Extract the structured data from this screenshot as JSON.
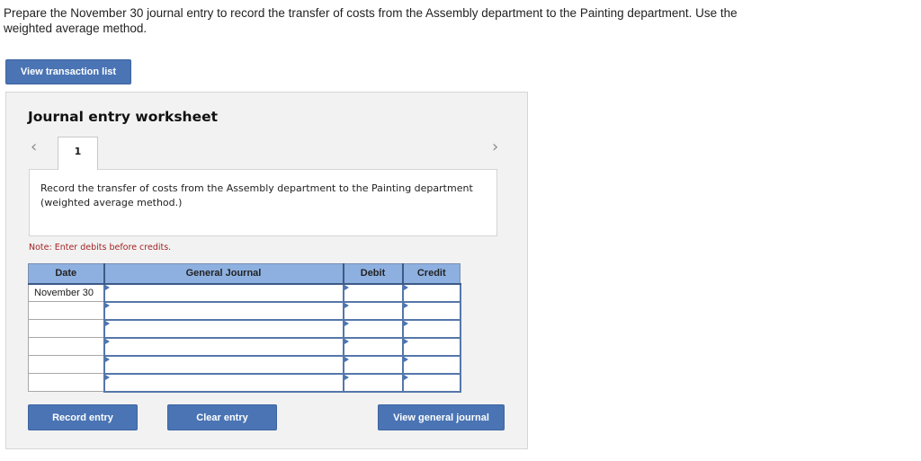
{
  "prompt": {
    "text": "Prepare the November 30 journal entry to record the transfer of costs from the Assembly department to the Painting department. Use the weighted average method."
  },
  "buttons": {
    "view_transaction_list": "View transaction list",
    "record_entry": "Record entry",
    "clear_entry": "Clear entry",
    "view_general_journal": "View general journal"
  },
  "worksheet": {
    "title": "Journal entry worksheet",
    "nav_prev_icon": "‹",
    "nav_next_icon": "›",
    "active_tab": "1",
    "description": "Record the transfer of costs from the Assembly department to the Painting department (weighted average method.)",
    "note": "Note: Enter debits before credits."
  },
  "journal_table": {
    "headers": {
      "date": "Date",
      "account": "General Journal",
      "debit": "Debit",
      "credit": "Credit"
    },
    "rows": [
      {
        "date": "November 30",
        "account": "",
        "debit": "",
        "credit": ""
      },
      {
        "date": "",
        "account": "",
        "debit": "",
        "credit": ""
      },
      {
        "date": "",
        "account": "",
        "debit": "",
        "credit": ""
      },
      {
        "date": "",
        "account": "",
        "debit": "",
        "credit": ""
      },
      {
        "date": "",
        "account": "",
        "debit": "",
        "credit": ""
      },
      {
        "date": "",
        "account": "",
        "debit": "",
        "credit": ""
      }
    ]
  },
  "colors": {
    "button": "#4a74b4",
    "header": "#8db0e0",
    "note": "#a32424"
  }
}
